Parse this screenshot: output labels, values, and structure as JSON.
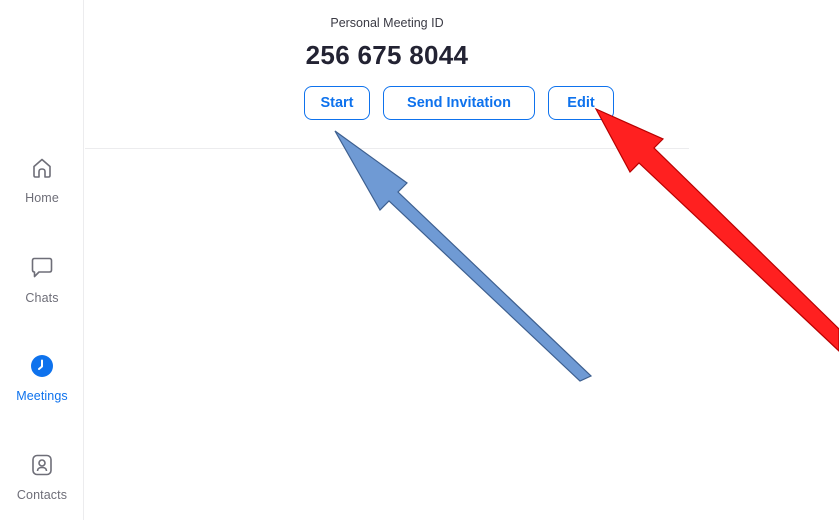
{
  "sidebar": {
    "items": [
      {
        "label": "Home",
        "icon": "home-icon",
        "active": false
      },
      {
        "label": "Chats",
        "icon": "chat-bubble-icon",
        "active": false
      },
      {
        "label": "Meetings",
        "icon": "clock-icon",
        "active": true
      },
      {
        "label": "Contacts",
        "icon": "contact-card-icon",
        "active": false
      }
    ]
  },
  "meeting": {
    "pmi_label": "Personal Meeting ID",
    "pmi_number": "256 675 8044",
    "buttons": {
      "start": "Start",
      "send_invitation": "Send Invitation",
      "edit": "Edit"
    }
  },
  "colors": {
    "accent": "#0e72ed",
    "text_dark": "#232333",
    "text_muted": "#6e6e78",
    "arrow_blue": "#6f9ad4",
    "arrow_red": "#ff2020"
  }
}
